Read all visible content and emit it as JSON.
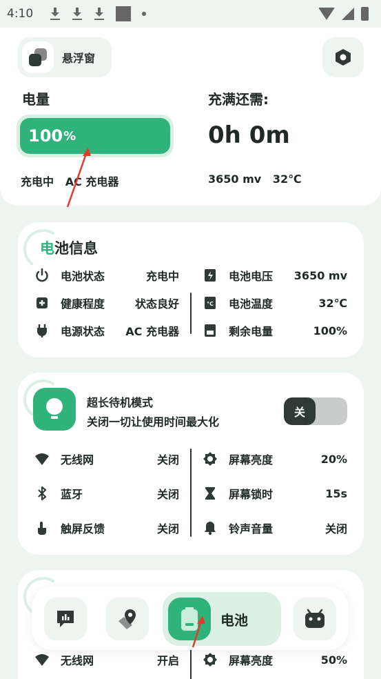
{
  "status_bar": {
    "time": "4:10"
  },
  "header": {
    "float_window_label": "悬浮窗"
  },
  "summary": {
    "power_label": "电量",
    "battery_percent": "100",
    "battery_percent_unit": "%",
    "battery_level": 1.0,
    "full_label": "充满还需:",
    "time_remaining": "0h 0m",
    "charge_status": "充电中",
    "charger_type": "AC 充电器",
    "voltage": "3650 mv",
    "temperature": "32℃"
  },
  "battery_info": {
    "title_accent": "电",
    "title_rest": "池信息",
    "left": [
      {
        "icon": "power-icon",
        "name": "电池状态",
        "value": "充电中"
      },
      {
        "icon": "health-icon",
        "name": "健康程度",
        "value": "状态良好"
      },
      {
        "icon": "plug-icon",
        "name": "电源状态",
        "value": "AC 充电器"
      }
    ],
    "right": [
      {
        "icon": "voltage-icon",
        "name": "电池电压",
        "value": "3650 mv"
      },
      {
        "icon": "temperature-icon",
        "name": "电池温度",
        "value": "32℃"
      },
      {
        "icon": "battery-icon",
        "name": "剩余电量",
        "value": "100%"
      }
    ]
  },
  "standby_mode": {
    "title": "超长待机模式",
    "subtitle": "关闭一切让使用时间最大化",
    "toggle_label": "关",
    "left": [
      {
        "icon": "wifi-icon",
        "name": "无线网",
        "value": "关闭"
      },
      {
        "icon": "bluetooth-icon",
        "name": "蓝牙",
        "value": "关闭"
      },
      {
        "icon": "touch-icon",
        "name": "触屏反馈",
        "value": "关闭"
      }
    ],
    "right": [
      {
        "icon": "brightness-icon",
        "name": "屏幕亮度",
        "value": "20%"
      },
      {
        "icon": "hourglass-icon",
        "name": "屏幕锁时",
        "value": "15s"
      },
      {
        "icon": "bell-icon",
        "name": "铃声音量",
        "value": "关闭"
      }
    ]
  },
  "third_mode": {
    "left": [
      {
        "icon": "wifi-icon",
        "name": "无线网",
        "value": "开启"
      }
    ],
    "right": [
      {
        "icon": "brightness-icon",
        "name": "屏幕亮度",
        "value": "50%"
      }
    ]
  },
  "nav": {
    "active_label": "电池"
  },
  "colors": {
    "accent": "#2fb37b",
    "dark": "#2f3936",
    "background": "#eef5f1"
  }
}
